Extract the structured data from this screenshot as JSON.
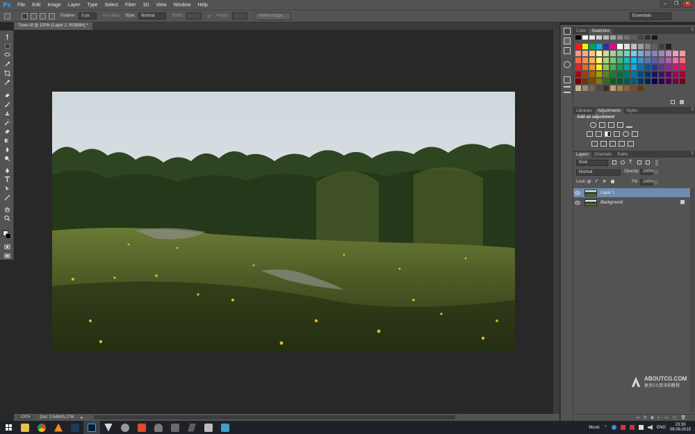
{
  "menubar": {
    "logo": "Ps",
    "items": [
      "File",
      "Edit",
      "Image",
      "Layer",
      "Type",
      "Select",
      "Filter",
      "3D",
      "View",
      "Window",
      "Help"
    ]
  },
  "options": {
    "feather_label": "Feather:",
    "feather_value": "0 px",
    "antialias_label": "Anti-alias",
    "style_label": "Style:",
    "style_value": "Normal",
    "width_label": "Width:",
    "height_label": "Height:",
    "refine_edge": "Refine Edge...",
    "workspace": "Essentials"
  },
  "document": {
    "tab_title": "Trees.tif @ 100% (Layer 1, RGB/8#) *",
    "zoom": "100%",
    "doc_size": "Doc: 2,64M/5,27M"
  },
  "panels": {
    "color_tabs": [
      "Color",
      "Swatches"
    ],
    "adjust_tabs": [
      "Libraries",
      "Adjustments",
      "Styles"
    ],
    "adjust_title": "Add an adjustment",
    "layer_tabs": [
      "Layers",
      "Channels",
      "Paths"
    ],
    "kind_value": "Kind",
    "blend_mode": "Normal",
    "opacity_label": "Opacity:",
    "opacity_value": "100%",
    "lock_label": "Lock:",
    "fill_label": "Fill:",
    "fill_value": "100%",
    "layers": [
      {
        "name": "Layer 1",
        "selected": true
      },
      {
        "name": "Background",
        "selected": false
      }
    ],
    "bottom_icons": [
      "link-icon",
      "fx-icon",
      "mask-icon",
      "adjustment-icon",
      "folder-icon",
      "new-layer-icon",
      "trash-icon"
    ]
  },
  "watermark": {
    "line1": "ABOUTCG.COM",
    "line2": "更多CG资讯和教程"
  },
  "taskbar": {
    "music_label": "Music",
    "lang": "ENG",
    "time": "23:33",
    "date": "09.09.2015"
  },
  "colors": {
    "accent": "#31a8ff",
    "layer_selected": "#6d8cb0",
    "taskbar": "#1e2228"
  }
}
